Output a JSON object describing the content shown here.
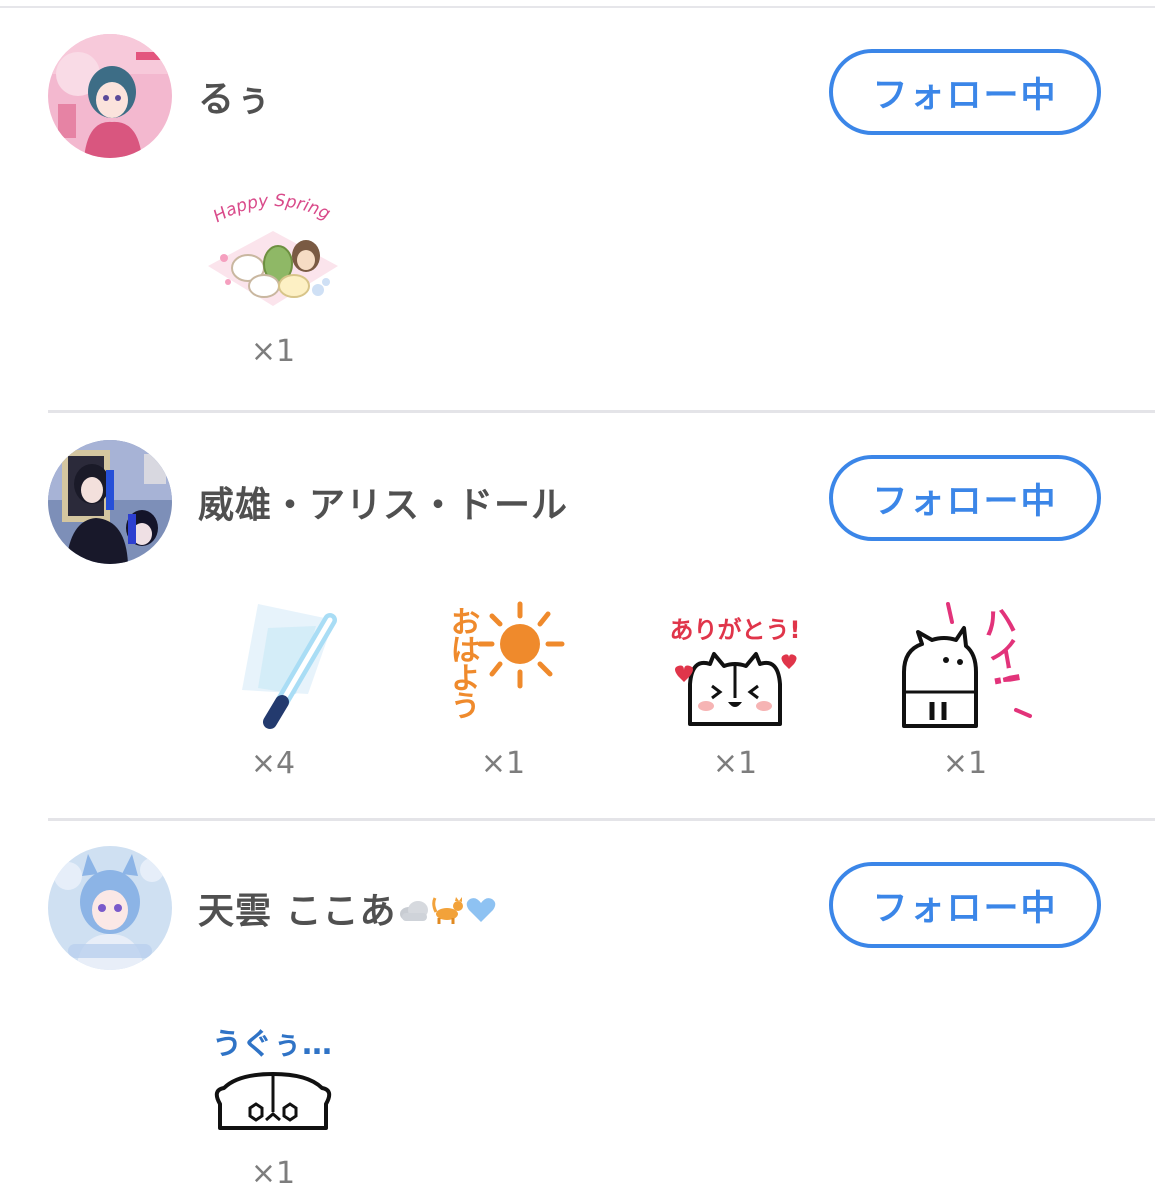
{
  "follow_label": "フォロー中",
  "colors": {
    "accent": "#3b86e8",
    "name_text": "#505050",
    "count_text": "#7d7d7d",
    "divider": "#e4e4e8"
  },
  "entries": [
    {
      "name": "るぅ",
      "gifts": [
        {
          "icon": "happy-spring-sticker",
          "text": "Happy Spring",
          "count": "×1"
        }
      ]
    },
    {
      "name": "威雄・アリス・ドール",
      "gifts": [
        {
          "icon": "penlight-sticker",
          "count": "×4"
        },
        {
          "icon": "ohayou-sun-sticker",
          "text": "おはよう",
          "count": "×1"
        },
        {
          "icon": "arigatou-cat-sticker",
          "text": "ありがとう!",
          "count": "×1"
        },
        {
          "icon": "hai-cat-sticker",
          "text": "ハイ!",
          "count": "×1"
        }
      ]
    },
    {
      "name": "天雲 ここあ",
      "name_emojis": [
        "cloud-emoji",
        "cat-emoji",
        "blue-heart-emoji"
      ],
      "gifts": [
        {
          "icon": "uguu-cat-sticker",
          "text": "うぐぅ…",
          "count": "×1"
        }
      ]
    }
  ]
}
